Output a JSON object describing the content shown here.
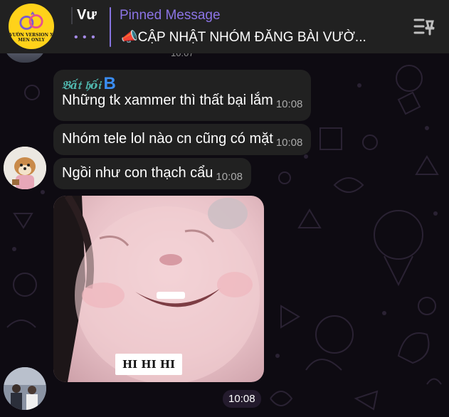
{
  "header": {
    "avatar_caption_line1": "VƯỜN VERSION X",
    "avatar_caption_line2": "MEN ONLY",
    "group_title": "Vư",
    "more_dots": "• • •",
    "pinned_label": "Pinned Message",
    "pinned_text": "📣CẬP NHẬT NHÓM ĐĂNG BÀI VƯỜ..."
  },
  "previous_message": {
    "time": "10:07"
  },
  "messages": [
    {
      "sender": "𝔅ấ𝔱 𝔥ố𝔦",
      "badge": "B",
      "text": "Những tk xammer thì thất bại lắm",
      "time": "10:08"
    },
    {
      "text": "Nhóm tele lol nào cn cũng có mặt",
      "time": "10:08"
    },
    {
      "text": "Ngồi như con thạch cẩu",
      "time": "10:08"
    }
  ],
  "sticker": {
    "caption": "HI HI HI",
    "time": "10:08"
  },
  "colors": {
    "accent": "#8774e1",
    "bubble": "#212121",
    "header": "#212121",
    "sender": "#4fb6ad"
  }
}
